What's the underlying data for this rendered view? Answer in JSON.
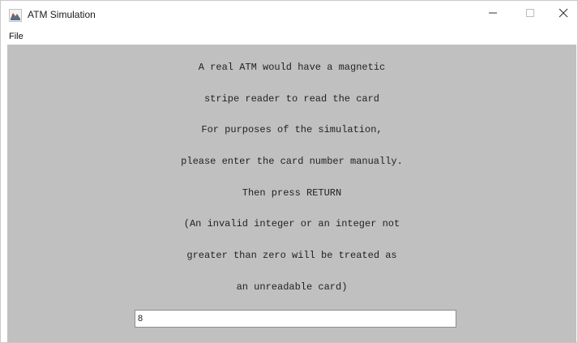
{
  "window": {
    "title": "ATM Simulation",
    "icons": {
      "app": "atm-app-icon",
      "minimize": "minimize-icon",
      "maximize": "maximize-icon",
      "close": "close-icon"
    }
  },
  "menu": {
    "items": [
      {
        "label": "File"
      }
    ]
  },
  "message": {
    "lines": [
      "A real ATM would have a magnetic",
      "stripe reader to read the card",
      "For purposes of the simulation,",
      "please enter the card number manually.",
      "Then press RETURN",
      "(An invalid integer or an integer not",
      "greater than zero will be treated as",
      "an unreadable card)"
    ]
  },
  "card_input": {
    "value": "8"
  },
  "colors": {
    "panel_background": "#c0c0c0",
    "titlebar_background": "#ffffff",
    "text": "#222222"
  }
}
